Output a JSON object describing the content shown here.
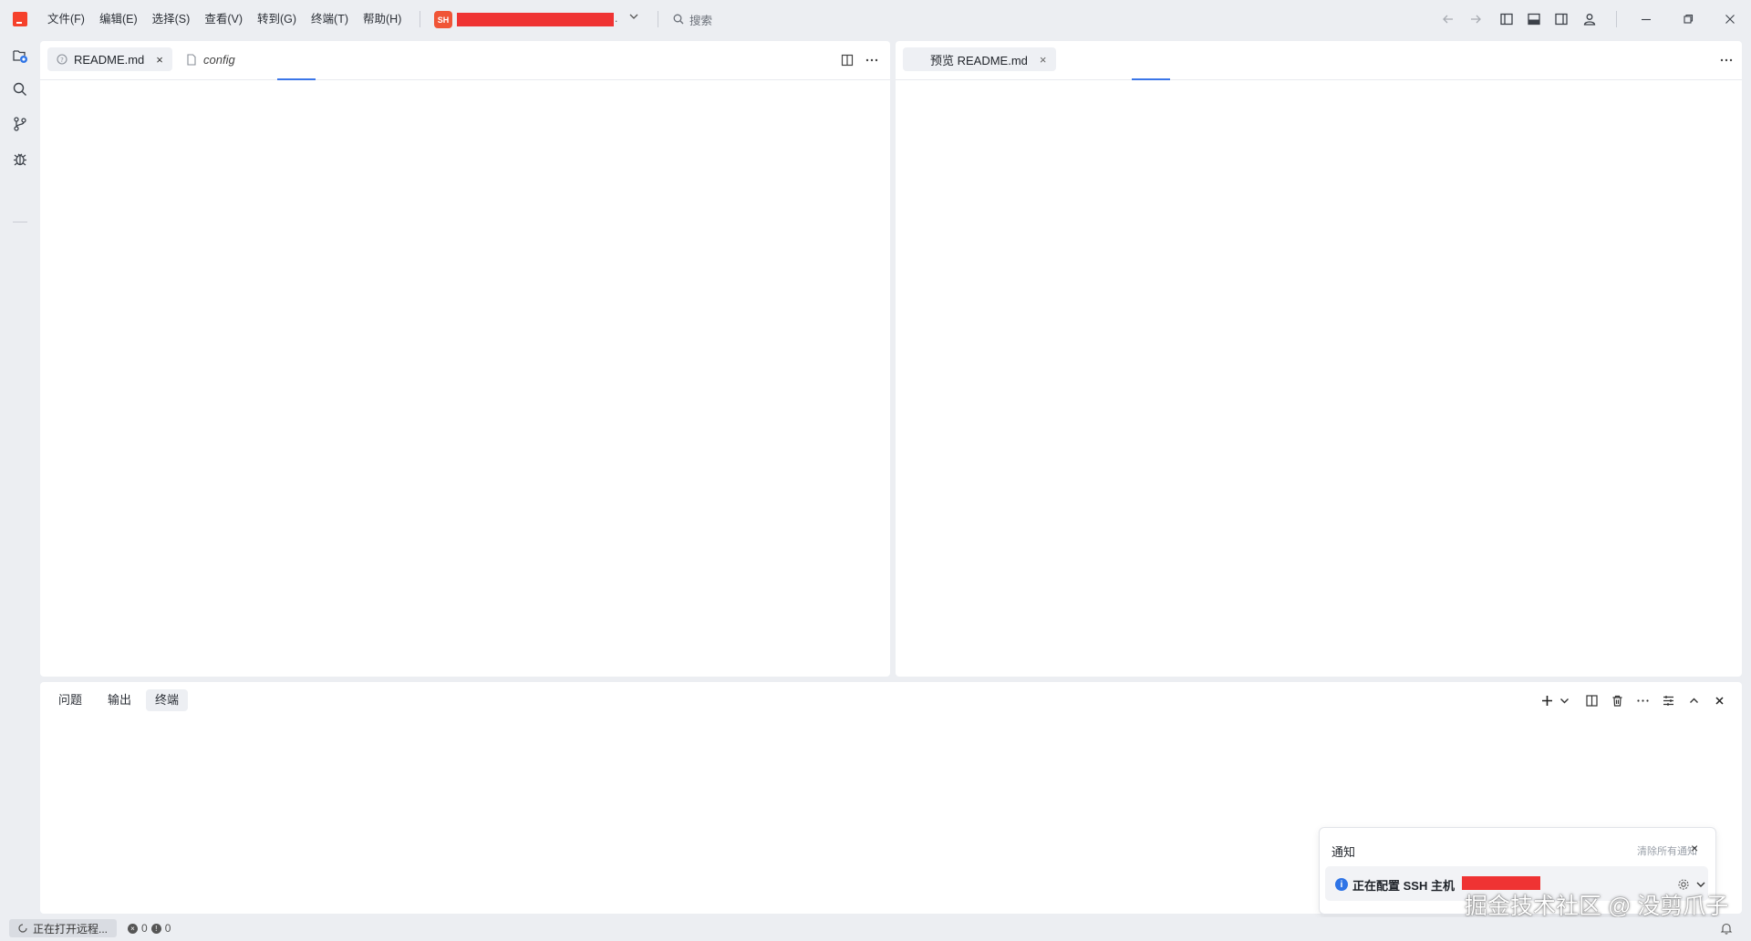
{
  "menu": [
    "文件(F)",
    "编辑(E)",
    "选择(S)",
    "查看(V)",
    "转到(G)",
    "终端(T)",
    "帮助(H)"
  ],
  "project": {
    "badge": "SH",
    "name": "",
    "suffix": "."
  },
  "search": {
    "label": "搜索"
  },
  "editor_left": {
    "tabs": [
      {
        "label": "README.md",
        "close": "×",
        "active": true
      },
      {
        "label": "config",
        "active": false
      }
    ]
  },
  "editor_right": {
    "tabs": [
      {
        "label": "预览 README.md",
        "close": "×",
        "active": true
      }
    ]
  },
  "panel": {
    "tabs": [
      {
        "label": "问题",
        "active": false
      },
      {
        "label": "输出",
        "active": false
      },
      {
        "label": "终端",
        "active": true
      }
    ]
  },
  "notifications": {
    "title": "通知",
    "clear_all": "清除所有通知",
    "close": "×",
    "items": [
      {
        "icon": "info-icon",
        "message": "正在配置 SSH 主机"
      }
    ]
  },
  "watermark": "掘金技术社区 @ 没剪爪子",
  "status": {
    "remote": "正在打开远程...",
    "errors": "0",
    "warnings": "0"
  },
  "colors": {
    "accent": "#3b76e8",
    "brand": "#f5402b",
    "redaction": "#ef3333"
  }
}
